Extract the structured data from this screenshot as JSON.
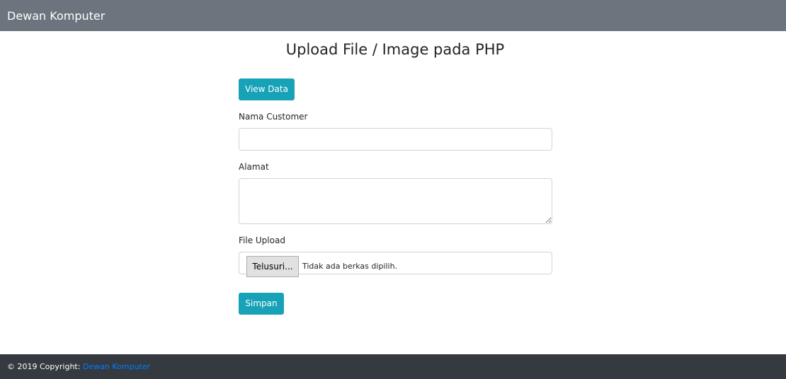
{
  "navbar": {
    "brand": "Dewan Komputer"
  },
  "page": {
    "title": "Upload File / Image pada PHP"
  },
  "form": {
    "view_data_label": "View Data",
    "nama_label": "Nama Customer",
    "nama_value": "",
    "alamat_label": "Alamat",
    "alamat_value": "",
    "file_label": "File Upload",
    "file_button_label": "Telusuri...",
    "file_status": "Tidak ada berkas dipilih.",
    "submit_label": "Simpan"
  },
  "footer": {
    "copyright": "© 2019 Copyright: ",
    "link_text": "Dewan Komputer"
  },
  "colors": {
    "navbar_bg": "#6c757d",
    "footer_bg": "#343a40",
    "button_info": "#17a2b8",
    "link": "#007bff"
  }
}
